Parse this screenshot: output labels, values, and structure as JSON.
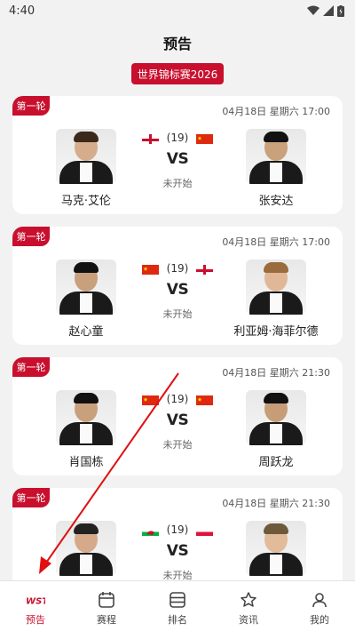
{
  "status_bar": {
    "time": "4:40"
  },
  "page_title": "预告",
  "event_badge": "世界锦标赛2026",
  "matches": [
    {
      "round": "第一轮",
      "date": "04月18日 星期六 17:00",
      "player1": {
        "name": "马克·艾伦",
        "flag": "northern-ireland"
      },
      "player2": {
        "name": "张安达",
        "flag": "china"
      },
      "seed": "(19)",
      "vs": "VS",
      "status": "未开始"
    },
    {
      "round": "第一轮",
      "date": "04月18日 星期六 17:00",
      "player1": {
        "name": "赵心童",
        "flag": "china"
      },
      "player2": {
        "name": "利亚姆·海菲尔德",
        "flag": "england"
      },
      "seed": "(19)",
      "vs": "VS",
      "status": "未开始"
    },
    {
      "round": "第一轮",
      "date": "04月18日 星期六 21:30",
      "player1": {
        "name": "肖国栋",
        "flag": "china"
      },
      "player2": {
        "name": "周跃龙",
        "flag": "china"
      },
      "seed": "(19)",
      "vs": "VS",
      "status": "未开始"
    },
    {
      "round": "第一轮",
      "date": "04月18日 星期六 21:30",
      "player1": {
        "name": "",
        "flag": "wales"
      },
      "player2": {
        "name": "",
        "flag": "poland"
      },
      "seed": "(19)",
      "vs": "VS",
      "status": "未开始"
    }
  ],
  "tabs": [
    {
      "label": "预告",
      "icon": "wst-logo-icon",
      "active": true
    },
    {
      "label": "赛程",
      "icon": "calendar-icon"
    },
    {
      "label": "排名",
      "icon": "ranking-icon"
    },
    {
      "label": "资讯",
      "icon": "star-icon"
    },
    {
      "label": "我的",
      "icon": "user-icon"
    }
  ],
  "colors": {
    "accent": "#c8102e",
    "background": "#f2f2f2",
    "annotation_arrow": "#e01010"
  }
}
